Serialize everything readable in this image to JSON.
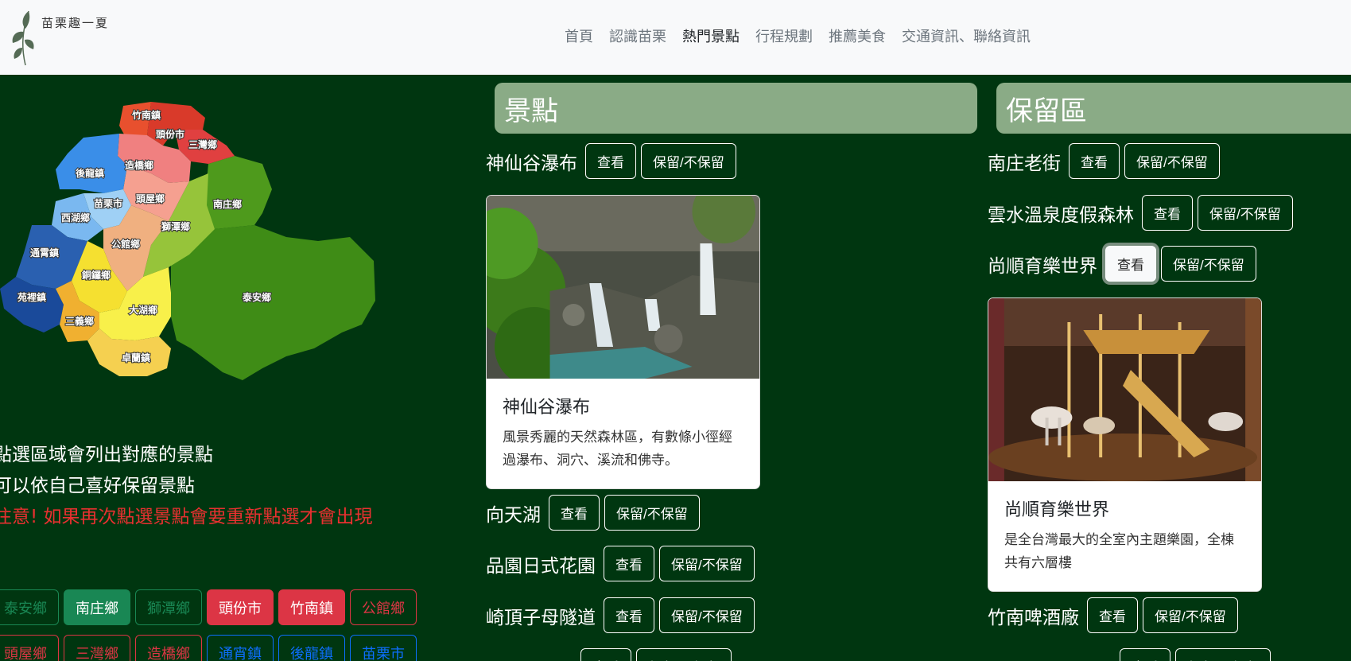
{
  "nav": {
    "brand": "苗栗趣一夏",
    "links": [
      "首頁",
      "認識苗栗",
      "熱門景點",
      "行程規劃",
      "推薦美食",
      "交通資訊、聯絡資訊"
    ],
    "active_index": 2
  },
  "map": {
    "regions": [
      "竹南鎮",
      "頭份市",
      "三灣鄉",
      "後龍鎮",
      "造橋鄉",
      "南庄鄉",
      "苗栗市",
      "頭屋鄉",
      "西湖鄉",
      "獅潭鄉",
      "公館鄉",
      "通霄鎮",
      "銅鑼鄉",
      "泰安鄉",
      "苑裡鎮",
      "大湖鄉",
      "三義鄉",
      "卓蘭鎮"
    ]
  },
  "notes": {
    "line1": "點選區域會列出對應的景點",
    "line2": "可以依自己喜好保留景點",
    "warning": "注意! 如果再次點選景點會要重新點選才會出現"
  },
  "region_buttons": {
    "row1": [
      "泰安鄉",
      "南庄鄉",
      "獅潭鄉",
      "頭份市",
      "竹南鎮",
      "公館鄉"
    ],
    "row2": [
      "頭屋鄉",
      "三灣鄉",
      "造橋鄉",
      "通宵鎮",
      "後龍鎮",
      "苗栗市"
    ]
  },
  "buttons": {
    "view": "查看",
    "keep": "保留/不保留"
  },
  "spots": {
    "heading": "景點",
    "items": [
      "神仙谷瀑布",
      "向天湖",
      "品園日式花園",
      "崎頂子母隧道"
    ],
    "card": {
      "title": "神仙谷瀑布",
      "text": "風景秀麗的天然森林區，有數條小徑經過瀑布、洞穴、溪流和佛寺。"
    }
  },
  "reserved": {
    "heading": "保留區",
    "items": [
      "南庄老街",
      "雲水溫泉度假森林",
      "尚順育樂世界",
      "竹南啤酒廠"
    ],
    "card": {
      "title": "尚順育樂世界",
      "text": "是全台灣最大的全室內主題樂園，全棟共有六層樓"
    }
  },
  "colors": {
    "bg": "#003610",
    "header": "#8aab86",
    "red": "#dc3545",
    "green": "#198754",
    "blue": "#0d6efd"
  }
}
